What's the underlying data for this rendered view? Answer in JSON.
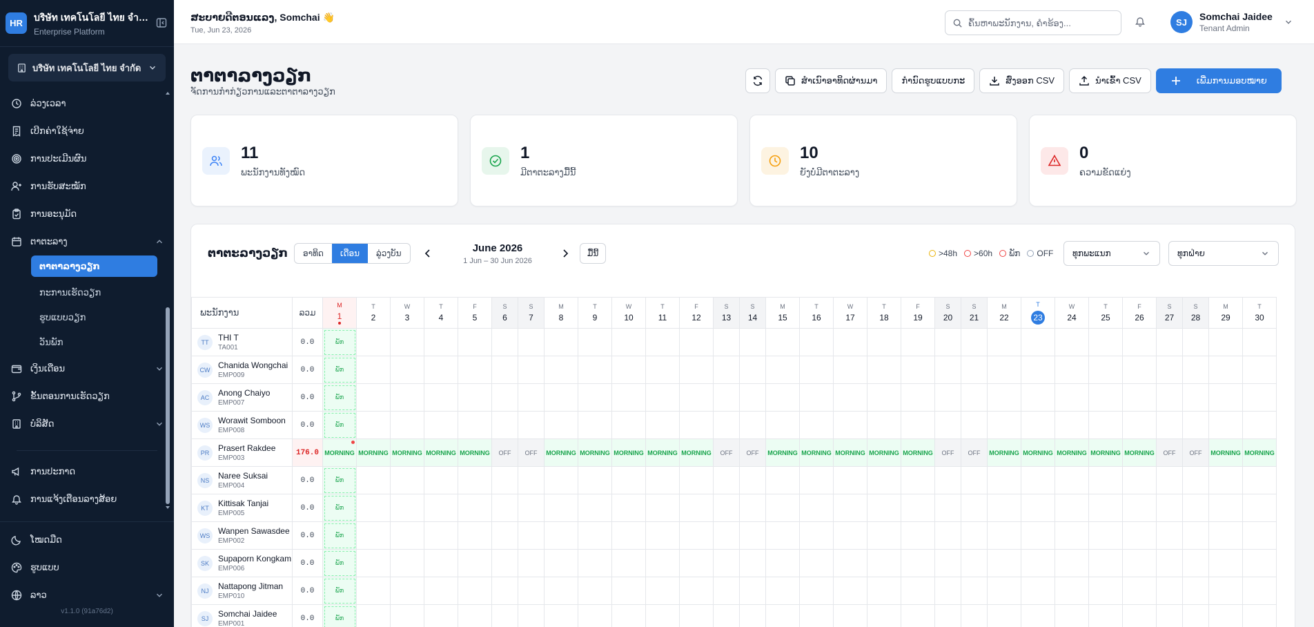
{
  "sidebar": {
    "logo": "HR",
    "company": "บริษัท เทคโนโลยี ไทย จำกัด",
    "platform": "Enterprise Platform",
    "tenant": "บริษัท เทคโนโลยี ไทย จำกัด",
    "items": [
      {
        "label": "ລ່ວງເວລາ",
        "icon": "clock-icon"
      },
      {
        "label": "ເບີກຄ່າໃຊ້ຈ່າຍ",
        "icon": "receipt-icon"
      },
      {
        "label": "ການປະເມີນຜົນ",
        "icon": "target-icon"
      },
      {
        "label": "ການຮັບສະໝັກ",
        "icon": "user-plus-icon"
      },
      {
        "label": "ການອະນຸມັດ",
        "icon": "clipboard-check-icon"
      },
      {
        "label": "ຕາຕະລາງ",
        "icon": "calendar-icon"
      }
    ],
    "subitems": [
      "ຕາຕາລາງວຽກ",
      "ກະການເຮັດວຽກ",
      "ຮູບແບບວຽກ",
      "ວັນພັກ"
    ],
    "items2": [
      {
        "label": "ເງິນເດືອນ",
        "icon": "wallet-icon"
      },
      {
        "label": "ຂັ້ນຕອນການເຮັດວຽກ",
        "icon": "workflow-icon"
      },
      {
        "label": "ບໍລິສັດ",
        "icon": "building-icon"
      }
    ],
    "items3": [
      {
        "label": "ການປະກາດ",
        "icon": "megaphone-icon"
      },
      {
        "label": "ການແຈ້ງເຕືອນລາງສ້ອຍ",
        "icon": "bell-icon"
      }
    ],
    "footer": [
      {
        "label": "ໂໝດມືດ",
        "icon": "moon-icon"
      },
      {
        "label": "ຮູບແບບ",
        "icon": "palette-icon"
      },
      {
        "label": "ລາວ",
        "icon": "globe-icon"
      }
    ],
    "version": "v1.1.0 (91a76d2)"
  },
  "topbar": {
    "greeting": "ສະບາຍດີຕອນແລງ, Somchai 👋",
    "date": "Tue, Jun 23, 2026",
    "search_placeholder": "ຄົ້ນຫາພະນັກງານ, ຄຳຮ້ອງ...",
    "user_initials": "SJ",
    "user_name": "Somchai Jaidee",
    "user_role": "Tenant Admin"
  },
  "page": {
    "title": "ຕາຕາລາງວຽກ",
    "subtitle": "ຈັດການກຳກ່ຽວການແລະຕາຕາລາງວຽກ",
    "actions": {
      "copy": "ສຳເນົາອາທິດຜ່ານມາ",
      "pattern": "ກຳນົດຮູບແບບກະ",
      "export": "ສົ່ງອອກ CSV",
      "import": "ນຳເຂົ້າ CSV",
      "assign": "ເພີ່ມການມອບໝາຍ"
    }
  },
  "stats": [
    {
      "value": "11",
      "label": "ພະນັກງານທັງໝົດ",
      "icon": "users-icon",
      "color": "#3b82f6",
      "bg": "#eaf2fd"
    },
    {
      "value": "1",
      "label": "ມີຕາຕະລາງມື້ນີ້",
      "icon": "check-circle-icon",
      "color": "#16a34a",
      "bg": "#e7f6ec"
    },
    {
      "value": "10",
      "label": "ຍັງບໍ່ມີຕາຕະລາງ",
      "icon": "clock-icon",
      "color": "#f59e0b",
      "bg": "#fdf3e1"
    },
    {
      "value": "0",
      "label": "ຄວາມຂັດແຍ່ງ",
      "icon": "alert-triangle-icon",
      "color": "#dc2626",
      "bg": "#fde8e8"
    }
  ],
  "roster": {
    "title": "ຕາຕະລາງວຽກ",
    "views": [
      "ອາທິດ",
      "ເດືອນ",
      "ລູ່ວງບັນ"
    ],
    "month": "June 2026",
    "range": "1 Jun – 30 Jun 2026",
    "today": "ມື້ນີ້",
    "legend": [
      {
        "label": ">48h",
        "color": "#eab308"
      },
      {
        "label": ">60h",
        "color": "#ef4444"
      },
      {
        "label": "ພັກ",
        "color": "#ef4444"
      },
      {
        "label": "OFF",
        "color": "#94a3b8"
      }
    ],
    "filter_dept": "ທຸກພະແນກ",
    "filter_pos": "ທຸກຝ່າຍ",
    "col_employee": "ພະນັກງານ",
    "col_total": "ລວມ",
    "days": [
      {
        "n": "1",
        "w": "M"
      },
      {
        "n": "2",
        "w": "T"
      },
      {
        "n": "3",
        "w": "W"
      },
      {
        "n": "4",
        "w": "T"
      },
      {
        "n": "5",
        "w": "F"
      },
      {
        "n": "6",
        "w": "S"
      },
      {
        "n": "7",
        "w": "S"
      },
      {
        "n": "8",
        "w": "M"
      },
      {
        "n": "9",
        "w": "T"
      },
      {
        "n": "10",
        "w": "W"
      },
      {
        "n": "11",
        "w": "T"
      },
      {
        "n": "12",
        "w": "F"
      },
      {
        "n": "13",
        "w": "S"
      },
      {
        "n": "14",
        "w": "S"
      },
      {
        "n": "15",
        "w": "M"
      },
      {
        "n": "16",
        "w": "T"
      },
      {
        "n": "17",
        "w": "W"
      },
      {
        "n": "18",
        "w": "T"
      },
      {
        "n": "19",
        "w": "F"
      },
      {
        "n": "20",
        "w": "S"
      },
      {
        "n": "21",
        "w": "S"
      },
      {
        "n": "22",
        "w": "M"
      },
      {
        "n": "23",
        "w": "T"
      },
      {
        "n": "24",
        "w": "W"
      },
      {
        "n": "25",
        "w": "T"
      },
      {
        "n": "26",
        "w": "F"
      },
      {
        "n": "27",
        "w": "S"
      },
      {
        "n": "28",
        "w": "S"
      },
      {
        "n": "29",
        "w": "M"
      },
      {
        "n": "30",
        "w": "T"
      }
    ],
    "leave_label": "ພັກ",
    "employees": [
      {
        "initials": "TT",
        "name": "THI T",
        "code": "TA001",
        "total": "0.0"
      },
      {
        "initials": "CW",
        "name": "Chanida Wongchai",
        "code": "EMP009",
        "total": "0.0"
      },
      {
        "initials": "AC",
        "name": "Anong Chaiyo",
        "code": "EMP007",
        "total": "0.0"
      },
      {
        "initials": "WS",
        "name": "Worawit Somboon",
        "code": "EMP008",
        "total": "0.0"
      },
      {
        "initials": "PR",
        "name": "Prasert Rakdee",
        "code": "EMP003",
        "total": "176.0",
        "shifts": true
      },
      {
        "initials": "NS",
        "name": "Naree Suksai",
        "code": "EMP004",
        "total": "0.0"
      },
      {
        "initials": "KT",
        "name": "Kittisak Tanjai",
        "code": "EMP005",
        "total": "0.0"
      },
      {
        "initials": "WS",
        "name": "Wanpen Sawasdee",
        "code": "EMP002",
        "total": "0.0"
      },
      {
        "initials": "SK",
        "name": "Supaporn Kongkam",
        "code": "EMP006",
        "total": "0.0"
      },
      {
        "initials": "NJ",
        "name": "Nattapong Jitman",
        "code": "EMP010",
        "total": "0.0"
      },
      {
        "initials": "SJ",
        "name": "Somchai Jaidee",
        "code": "EMP001",
        "total": "0.0"
      }
    ],
    "shift_labels": {
      "on": "MORNING",
      "off": "OFF"
    }
  }
}
